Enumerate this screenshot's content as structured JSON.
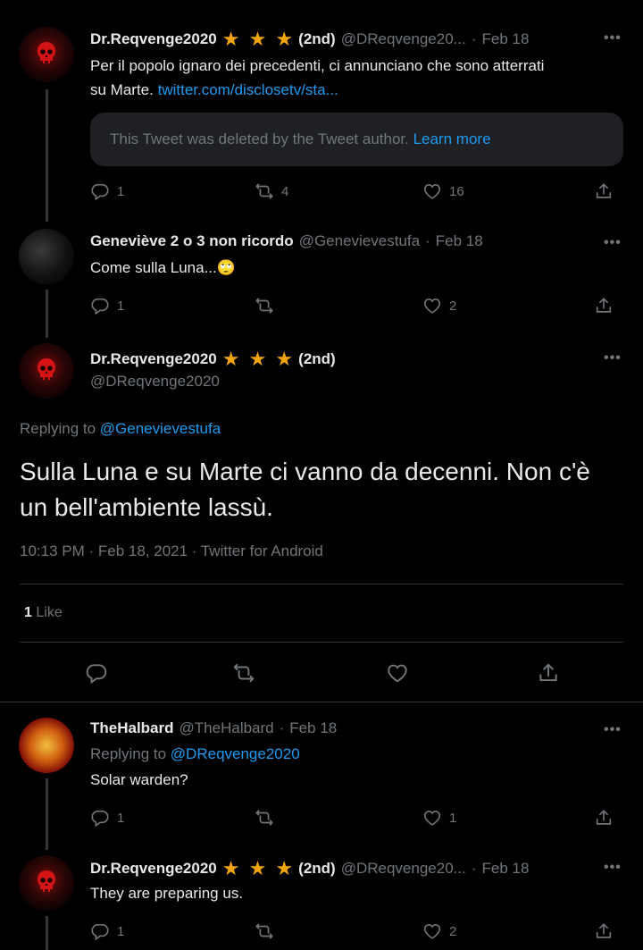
{
  "tweets": [
    {
      "name": "Dr.Reqvenge2020",
      "stars": "★ ★ ★",
      "badge": "(2nd)",
      "handle": "@DReqvenge20...",
      "date": "Feb 18",
      "text_line1": "Per il popolo ignaro dei precedenti, ci annunciano che sono atterrati",
      "text_line2": "su Marte.",
      "link": "twitter.com/disclosetv/sta...",
      "deleted_text": "This Tweet was deleted by the Tweet author.",
      "deleted_link": "Learn more",
      "replies": "1",
      "retweets": "4",
      "likes": "16"
    },
    {
      "name": "Geneviève 2 o 3 non ricordo",
      "handle": "@Genevievestufa",
      "date": "Feb 18",
      "text": "Come sulla Luna...",
      "emoji": "🙄",
      "replies": "1",
      "retweets": "",
      "likes": "2"
    }
  ],
  "main_tweet": {
    "name": "Dr.Reqvenge2020",
    "stars": "★ ★ ★",
    "badge": "(2nd)",
    "handle": "@DReqvenge2020",
    "replying_label": "Replying to",
    "replying_to": "@Genevievestufa",
    "text": "Sulla Luna e su Marte ci vanno da decenni. Non c'è un bell'ambiente lassù.",
    "meta": "10:13 PM · Feb 18, 2021 · Twitter for Android",
    "likes_count": "1",
    "likes_label": "Like"
  },
  "replies": [
    {
      "name": "TheHalbard",
      "handle": "@TheHalbard",
      "date": "Feb 18",
      "replying_label": "Replying to",
      "replying_to": "@DReqvenge2020",
      "text": "Solar warden?",
      "replies": "1",
      "retweets": "",
      "likes": "1"
    },
    {
      "name": "Dr.Reqvenge2020",
      "stars": "★ ★ ★",
      "badge": "(2nd)",
      "handle": "@DReqvenge20...",
      "date": "Feb 18",
      "text": "They are preparing us.",
      "replies": "1",
      "retweets": "",
      "likes": "2"
    }
  ],
  "ui": {
    "dot": "·",
    "more": "•••"
  },
  "colors": {
    "background": "#000000",
    "text": "#e7e9ea",
    "muted": "#71767b",
    "link": "#1d9bf0",
    "star": "#f4a40b"
  }
}
